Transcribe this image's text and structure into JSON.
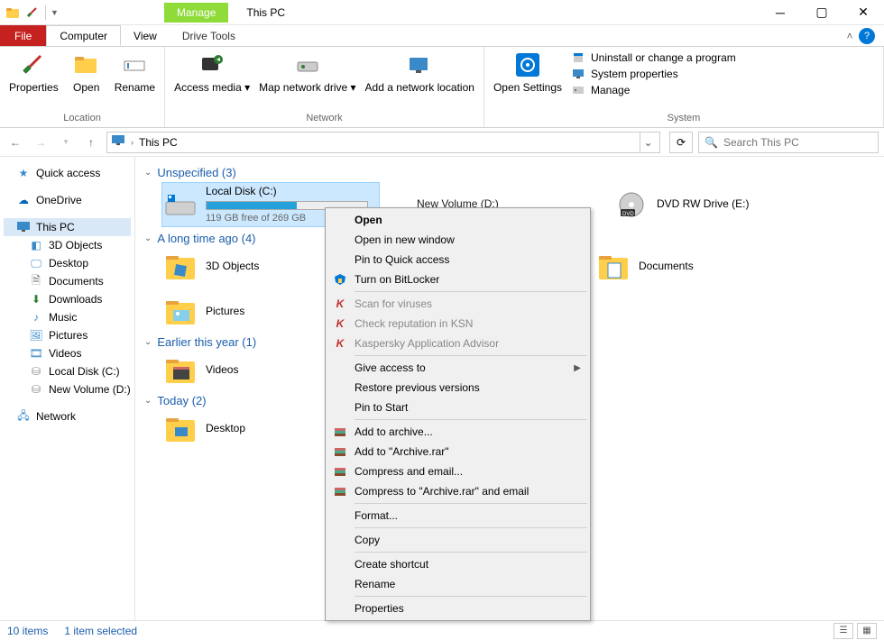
{
  "title": "This PC",
  "manage_tab": "Manage",
  "tabs": {
    "file": "File",
    "computer": "Computer",
    "view": "View",
    "drive": "Drive Tools"
  },
  "ribbon": {
    "location": {
      "label": "Location",
      "properties": "Properties",
      "open": "Open",
      "rename": "Rename"
    },
    "network": {
      "label": "Network",
      "access": "Access media",
      "map": "Map network drive",
      "add": "Add a network location"
    },
    "system": {
      "label": "System",
      "open_settings": "Open Settings",
      "uninstall": "Uninstall or change a program",
      "sysprops": "System properties",
      "manage": "Manage"
    }
  },
  "address": {
    "crumb": "This PC"
  },
  "search": {
    "placeholder": "Search This PC"
  },
  "tree": {
    "quick": "Quick access",
    "onedrive": "OneDrive",
    "thispc": "This PC",
    "objects3d": "3D Objects",
    "desktop": "Desktop",
    "documents": "Documents",
    "downloads": "Downloads",
    "music": "Music",
    "pictures": "Pictures",
    "videos": "Videos",
    "localc": "Local Disk (C:)",
    "newvol": "New Volume (D:)",
    "network": "Network"
  },
  "groups": {
    "unspecified": {
      "header": "Unspecified (3)",
      "localc": {
        "name": "Local Disk (C:)",
        "free": "119 GB free of 269 GB",
        "fill_pct": 56
      },
      "newvol": {
        "name": "New Volume (D:)"
      },
      "dvd": {
        "name": "DVD RW Drive (E:)"
      }
    },
    "longtime": {
      "header": "A long time ago (4)",
      "objects3d": "3D Objects",
      "pictures": "Pictures",
      "documents": "Documents"
    },
    "earlier": {
      "header": "Earlier this year (1)",
      "videos": "Videos"
    },
    "today": {
      "header": "Today (2)",
      "desktop": "Desktop"
    }
  },
  "ctx": {
    "open": "Open",
    "open_new": "Open in new window",
    "pin_quick": "Pin to Quick access",
    "bitlocker": "Turn on BitLocker",
    "scan": "Scan for viruses",
    "ksn": "Check reputation in KSN",
    "advisor": "Kaspersky Application Advisor",
    "give_access": "Give access to",
    "restore": "Restore previous versions",
    "pin_start": "Pin to Start",
    "add_archive": "Add to archive...",
    "add_archive_rar": "Add to \"Archive.rar\"",
    "compress_email": "Compress and email...",
    "compress_rar_email": "Compress to \"Archive.rar\" and email",
    "format": "Format...",
    "copy": "Copy",
    "shortcut": "Create shortcut",
    "rename": "Rename",
    "properties": "Properties"
  },
  "status": {
    "items": "10 items",
    "selected": "1 item selected"
  }
}
